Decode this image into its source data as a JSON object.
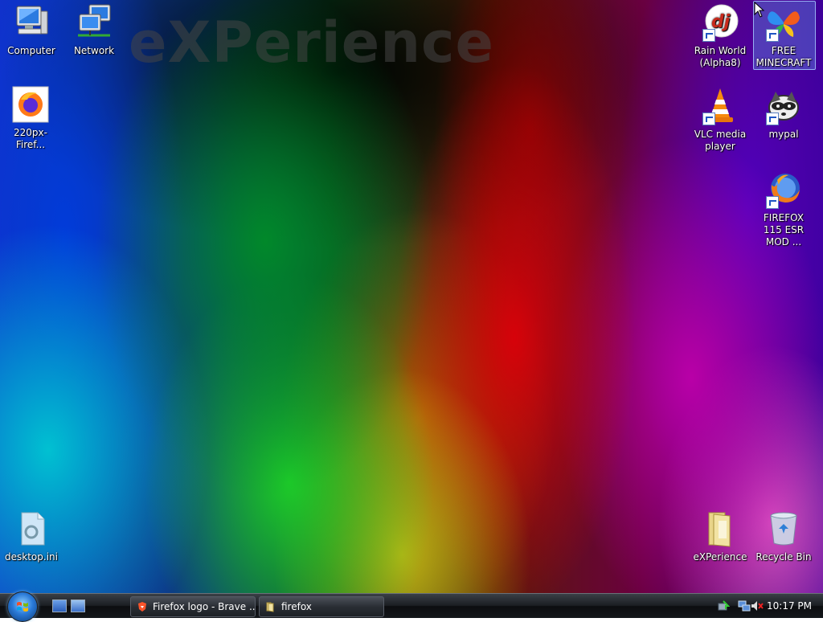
{
  "desktop": {
    "brand_text": "eXPerience",
    "icons": [
      {
        "label": "Computer",
        "icon": "computer-icon"
      },
      {
        "label": "Network",
        "icon": "network-icon"
      },
      {
        "label": "220px-Firef...",
        "icon": "firefox-image-icon"
      },
      {
        "label": "desktop.ini",
        "icon": "settings-file-icon"
      },
      {
        "label": "Rain World (Alpha8)",
        "icon": "dj-logo-icon"
      },
      {
        "label": "FREE MINECRAFT",
        "icon": "butterfly-icon"
      },
      {
        "label": "VLC media player",
        "icon": "vlc-cone-icon"
      },
      {
        "label": "mypal",
        "icon": "raccoon-icon"
      },
      {
        "label": "FIREFOX 115 ESR MOD ...",
        "icon": "firefox-icon"
      },
      {
        "label": "eXPerience",
        "icon": "folder-icon"
      },
      {
        "label": "Recycle Bin",
        "icon": "recycle-bin-icon"
      }
    ]
  },
  "taskbar": {
    "tasks": [
      {
        "label": "Firefox logo - Brave ...",
        "icon": "brave-lion-icon"
      },
      {
        "label": "firefox",
        "icon": "folder-icon"
      }
    ],
    "clock": "10:17 PM"
  }
}
